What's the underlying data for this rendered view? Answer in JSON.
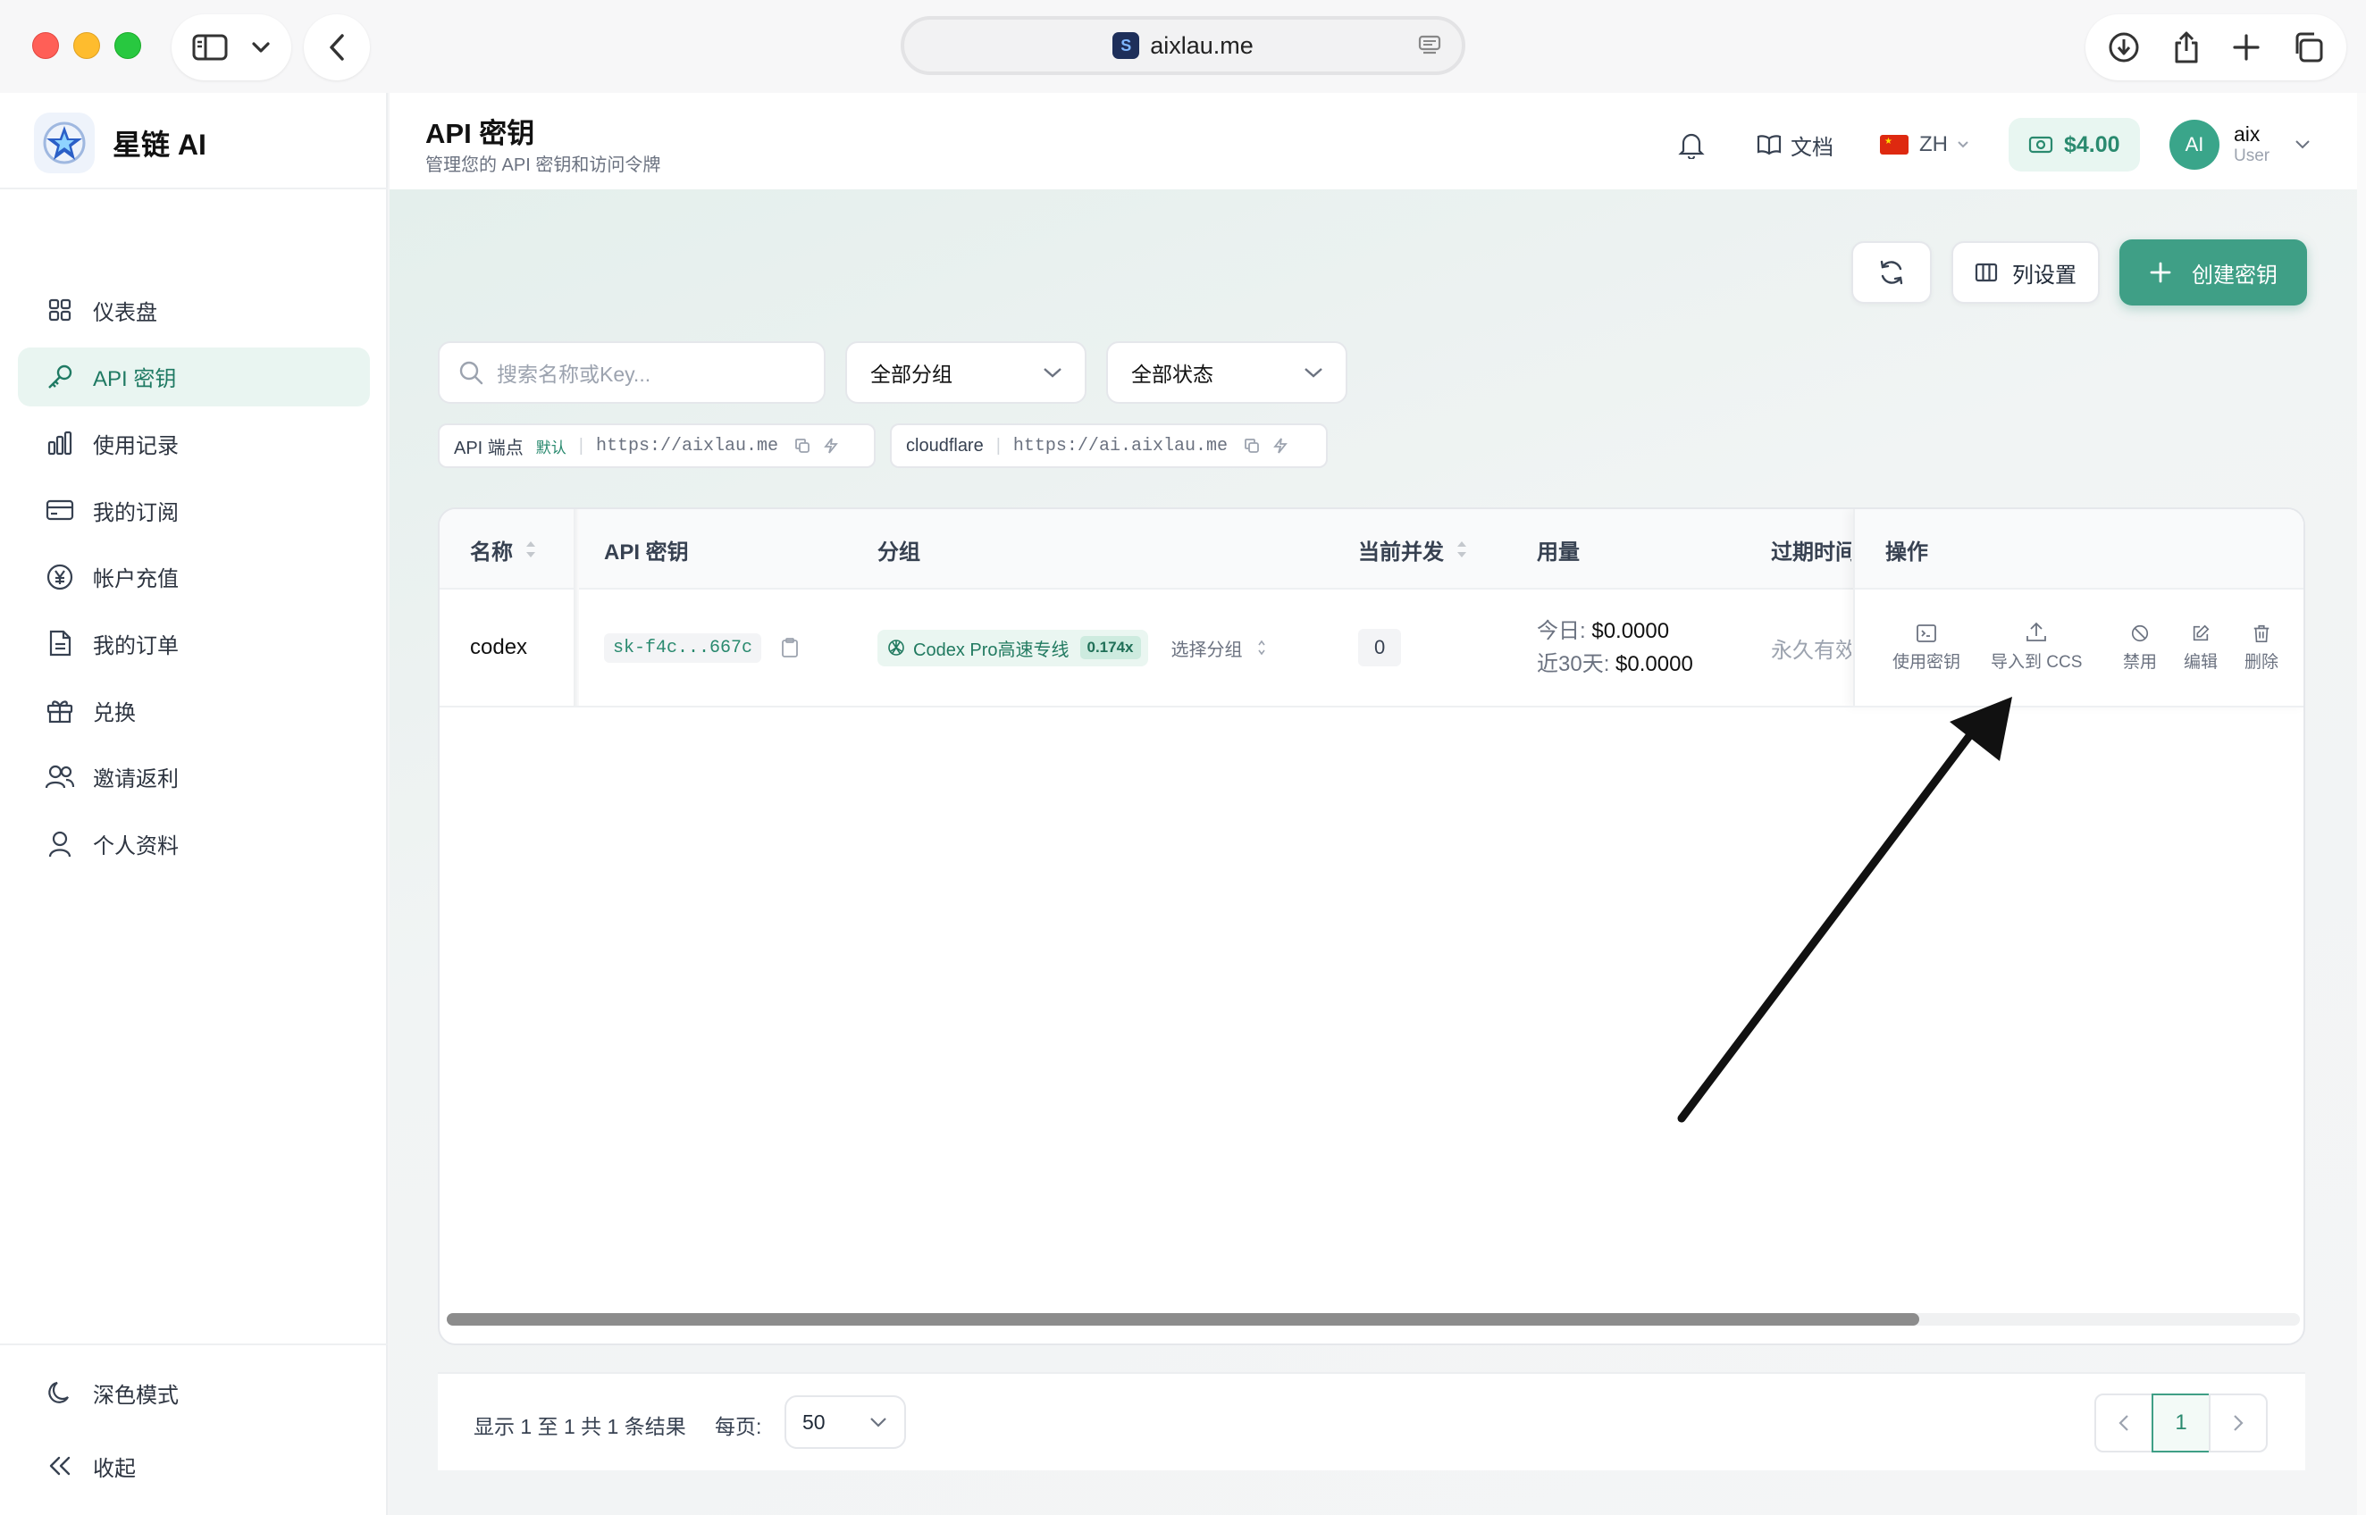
{
  "browser": {
    "url": "aixlau.me"
  },
  "brand": {
    "name": "星链 AI"
  },
  "sidebar": {
    "items": [
      {
        "label": "仪表盘",
        "icon": "grid-icon",
        "active": false
      },
      {
        "label": "API 密钥",
        "icon": "key-icon",
        "active": true
      },
      {
        "label": "使用记录",
        "icon": "bar-chart-icon",
        "active": false
      },
      {
        "label": "我的订阅",
        "icon": "card-icon",
        "active": false
      },
      {
        "label": "帐户充值",
        "icon": "yen-icon",
        "active": false
      },
      {
        "label": "我的订单",
        "icon": "document-icon",
        "active": false
      },
      {
        "label": "兑换",
        "icon": "gift-icon",
        "active": false
      },
      {
        "label": "邀请返利",
        "icon": "users-icon",
        "active": false
      },
      {
        "label": "个人资料",
        "icon": "user-icon",
        "active": false
      }
    ],
    "dark_mode_label": "深色模式",
    "collapse_label": "收起"
  },
  "header": {
    "title": "API 密钥",
    "subtitle": "管理您的 API 密钥和访问令牌",
    "docs_label": "文档",
    "lang_label": "ZH",
    "balance": "$4.00",
    "avatar_initials": "AI",
    "user_name": "aix",
    "user_role": "User"
  },
  "toolbar": {
    "columns_label": "列设置",
    "create_label": "创建密钥"
  },
  "filters": {
    "search_placeholder": "搜索名称或Key...",
    "group_select": "全部分组",
    "status_select": "全部状态"
  },
  "endpoints": [
    {
      "name": "API 端点",
      "badge": "默认",
      "url": "https://aixlau.me"
    },
    {
      "name": "cloudflare",
      "badge": "",
      "url": "https://ai.aixlau.me"
    }
  ],
  "table": {
    "columns": [
      "名称",
      "API 密钥",
      "分组",
      "当前并发",
      "用量",
      "过期时间",
      "操作"
    ],
    "rows": [
      {
        "name": "codex",
        "key": "sk-f4c...667c",
        "group": "Codex Pro高速专线",
        "rate": "0.174x",
        "select_group": "选择分组",
        "concurrency": "0",
        "usage_today_label": "今日:",
        "usage_today": "$0.0000",
        "usage_30d_label": "近30天:",
        "usage_30d": "$0.0000",
        "expiry": "永久有效"
      }
    ],
    "actions": [
      "使用密钥",
      "导入到 CCS",
      "禁用",
      "编辑",
      "删除"
    ]
  },
  "footer": {
    "summary": "显示 1 至 1 共 1 条结果",
    "per_page_label": "每页:",
    "per_page": "50",
    "current_page": "1"
  },
  "colors": {
    "accent": "#3f9f86",
    "active_bg": "#e9f5f1"
  }
}
